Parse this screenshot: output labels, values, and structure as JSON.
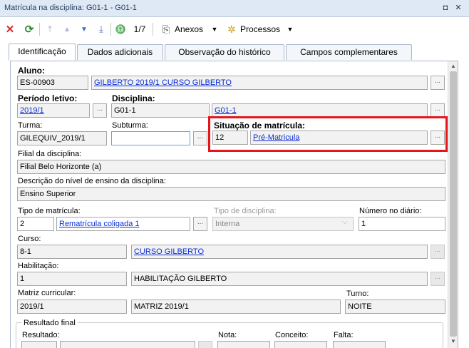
{
  "window": {
    "title": "Matrícula na disciplina: G01-1 - G01-1",
    "controls": {
      "restore": "◘",
      "close": "✕"
    }
  },
  "toolbar": {
    "record_counter": "1/7",
    "anexos_label": "Anexos",
    "processos_label": "Processos",
    "colors": {
      "delete": "#d62a2a",
      "refresh": "#2d8a2d",
      "nav": "#5a7fb8"
    }
  },
  "tabs": [
    {
      "label": "Identificação",
      "active": true
    },
    {
      "label": "Dados adicionais",
      "active": false
    },
    {
      "label": "Observação do histórico",
      "active": false
    },
    {
      "label": "Campos complementares",
      "active": false
    }
  ],
  "form": {
    "aluno": {
      "label": "Aluno:",
      "code": "ES-00903",
      "name": "GILBERTO 2019/1 CURSO GILBERTO"
    },
    "periodo": {
      "label": "Período letivo:",
      "value": "2019/1"
    },
    "disciplina": {
      "label": "Disciplina:",
      "code": "G01-1",
      "name": "G01-1"
    },
    "turma": {
      "label": "Turma:",
      "value": "GILEQUIV_2019/1"
    },
    "subturma": {
      "label": "Subturma:",
      "value": ""
    },
    "situacao": {
      "label": "Situação de matrícula:",
      "code": "12",
      "name": "Pré-Matricula"
    },
    "filial": {
      "label": "Filial da disciplina:",
      "value": "Filial Belo Horizonte (a)"
    },
    "nivel": {
      "label": "Descrição do nível de ensino da disciplina:",
      "value": "Ensino Superior"
    },
    "tipo_matricula": {
      "label": "Tipo de matrícula:",
      "code": "2",
      "name": "Rematrícula coligada 1"
    },
    "tipo_disciplina": {
      "label": "Tipo de disciplina:",
      "value": "Interna"
    },
    "numero_diario": {
      "label": "Número no diário:",
      "value": "1"
    },
    "curso": {
      "label": "Curso:",
      "code": "8-1",
      "name": "CURSO GILBERTO"
    },
    "habilitacao": {
      "label": "Habilitação:",
      "code": "1",
      "name": "HABILITAÇÃO GILBERTO"
    },
    "matriz": {
      "label": "Matriz curricular:",
      "code": "2019/1",
      "name": "MATRIZ 2019/1"
    },
    "turno": {
      "label": "Turno:",
      "value": "NOITE"
    },
    "resultado_final": {
      "title": "Resultado final",
      "resultado_label": "Resultado:",
      "nota_label": "Nota:",
      "conceito_label": "Conceito:",
      "falta_label": "Falta:"
    },
    "lookup_button": "..."
  },
  "highlight_color": "#e8141c"
}
